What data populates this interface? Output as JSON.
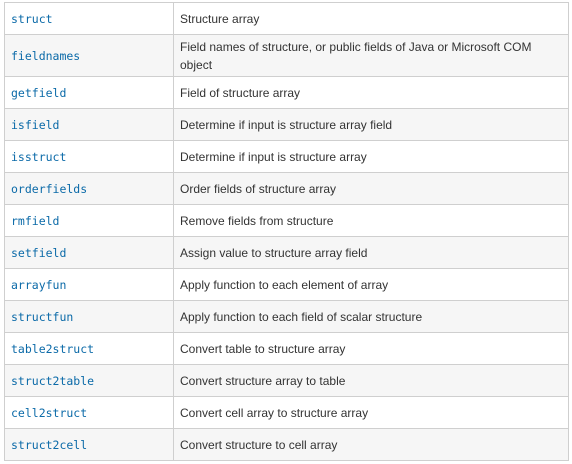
{
  "functions": [
    {
      "name": "struct",
      "description": "Structure array"
    },
    {
      "name": "fieldnames",
      "description": "Field names of structure, or public fields of Java or Microsoft COM object"
    },
    {
      "name": "getfield",
      "description": "Field of structure array"
    },
    {
      "name": "isfield",
      "description": "Determine if input is structure array field"
    },
    {
      "name": "isstruct",
      "description": "Determine if input is structure array"
    },
    {
      "name": "orderfields",
      "description": "Order fields of structure array"
    },
    {
      "name": "rmfield",
      "description": "Remove fields from structure"
    },
    {
      "name": "setfield",
      "description": "Assign value to structure array field"
    },
    {
      "name": "arrayfun",
      "description": "Apply function to each element of array"
    },
    {
      "name": "structfun",
      "description": "Apply function to each field of scalar structure"
    },
    {
      "name": "table2struct",
      "description": "Convert table to structure array"
    },
    {
      "name": "struct2table",
      "description": "Convert structure array to table"
    },
    {
      "name": "cell2struct",
      "description": "Convert cell array to structure array"
    },
    {
      "name": "struct2cell",
      "description": "Convert structure to cell array"
    }
  ],
  "colors": {
    "link": "#0b6aa8",
    "text": "#333333",
    "border": "#cfcfcf",
    "row_alt": "#f6f6f6"
  }
}
